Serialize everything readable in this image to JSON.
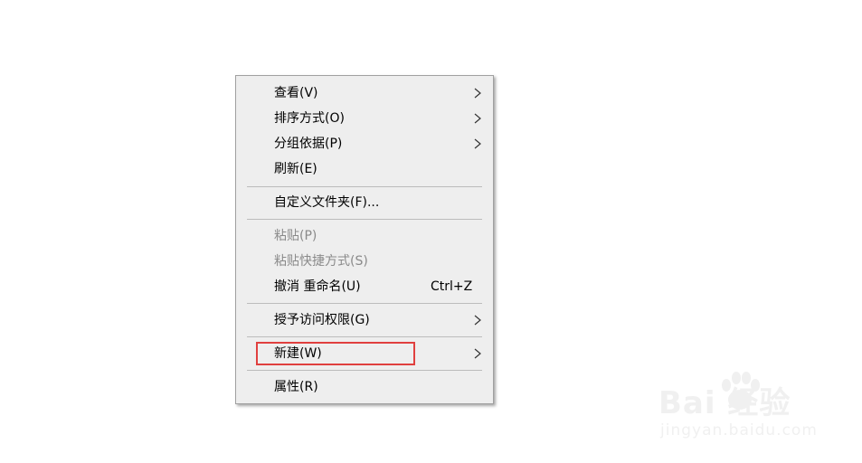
{
  "context_menu": {
    "items": [
      {
        "label": "查看(V)",
        "has_submenu": true,
        "disabled": false
      },
      {
        "label": "排序方式(O)",
        "has_submenu": true,
        "disabled": false
      },
      {
        "label": "分组依据(P)",
        "has_submenu": true,
        "disabled": false
      },
      {
        "label": "刷新(E)",
        "has_submenu": false,
        "disabled": false
      },
      {
        "label": "自定义文件夹(F)...",
        "has_submenu": false,
        "disabled": false
      },
      {
        "label": "粘贴(P)",
        "has_submenu": false,
        "disabled": true
      },
      {
        "label": "粘贴快捷方式(S)",
        "has_submenu": false,
        "disabled": true
      },
      {
        "label": "撤消 重命名(U)",
        "shortcut": "Ctrl+Z",
        "has_submenu": false,
        "disabled": false
      },
      {
        "label": "授予访问权限(G)",
        "has_submenu": true,
        "disabled": false
      },
      {
        "label": "新建(W)",
        "has_submenu": true,
        "disabled": false,
        "highlighted": true
      },
      {
        "label": "属性(R)",
        "has_submenu": false,
        "disabled": false
      }
    ]
  },
  "watermark": {
    "top_text": "Bai  经验",
    "bottom_text": "jingyan.baidu.com"
  },
  "colors": {
    "menu_background": "#eeeeee",
    "menu_border": "#a0a0a0",
    "separator": "#bcbcbc",
    "disabled_text": "#8a8a8a",
    "highlight_box": "#e0403f"
  }
}
